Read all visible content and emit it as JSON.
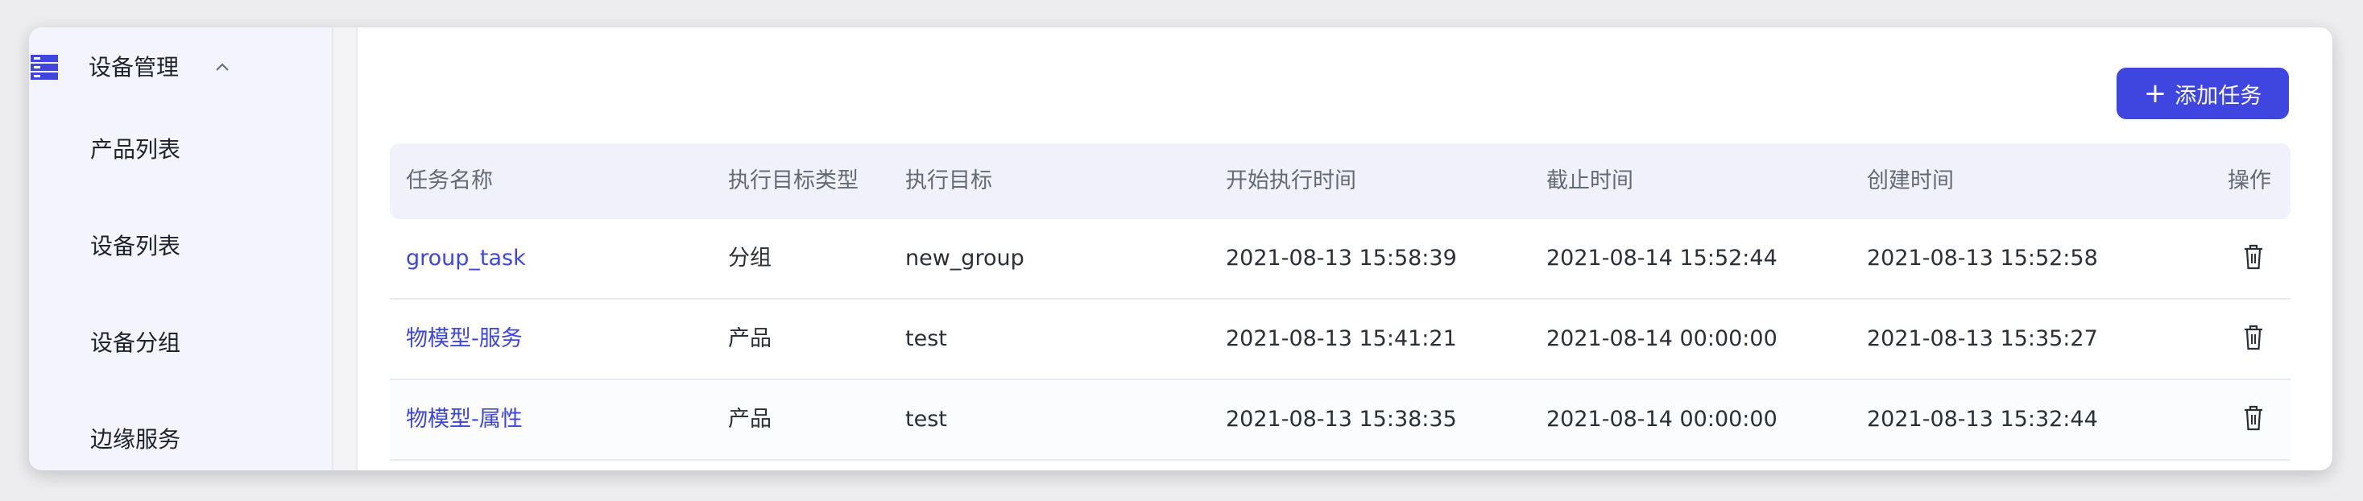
{
  "sidebar": {
    "group_label": "设备管理",
    "items": [
      {
        "label": "产品列表"
      },
      {
        "label": "设备列表"
      },
      {
        "label": "设备分组"
      },
      {
        "label": "边缘服务"
      }
    ]
  },
  "toolbar": {
    "add_task_label": "添加任务"
  },
  "table": {
    "headers": [
      "任务名称",
      "执行目标类型",
      "执行目标",
      "开始执行时间",
      "截止时间",
      "创建时间",
      "操作"
    ],
    "rows": [
      {
        "name": "group_task",
        "target_type": "分组",
        "target": "new_group",
        "start": "2021-08-13 15:58:39",
        "deadline": "2021-08-14 15:52:44",
        "created": "2021-08-13 15:52:58"
      },
      {
        "name": "物模型-服务",
        "target_type": "产品",
        "target": "test",
        "start": "2021-08-13 15:41:21",
        "deadline": "2021-08-14 00:00:00",
        "created": "2021-08-13 15:35:27"
      },
      {
        "name": "物模型-属性",
        "target_type": "产品",
        "target": "test",
        "start": "2021-08-13 15:38:35",
        "deadline": "2021-08-14 00:00:00",
        "created": "2021-08-13 15:32:44"
      }
    ]
  },
  "colors": {
    "accent": "#3f46e0",
    "sidebar_bg": "#f3f4fd",
    "header_bg": "#f0f1fb"
  },
  "icons": {
    "menu": "server-list-icon",
    "collapse": "chevron-up-icon",
    "delete": "trash-icon"
  }
}
